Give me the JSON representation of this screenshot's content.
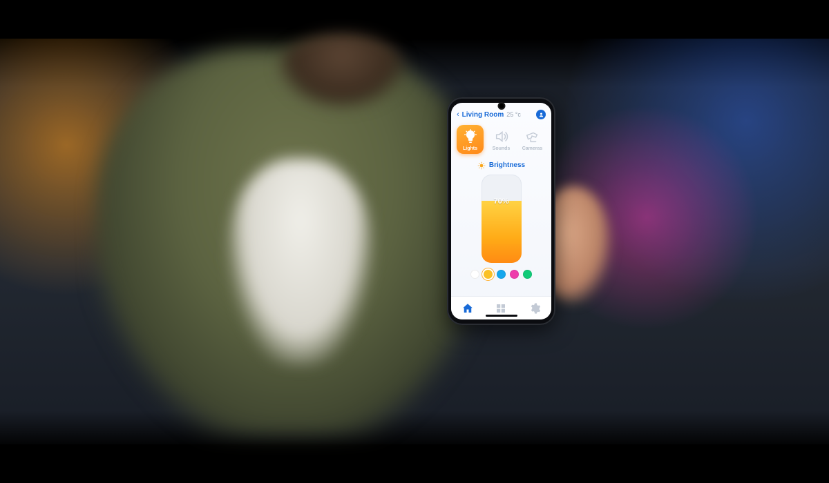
{
  "header": {
    "back_glyph": "‹",
    "room_name": "Living Room",
    "temperature": "25 °c"
  },
  "tabs": [
    {
      "id": "lights",
      "label": "Lights",
      "active": true
    },
    {
      "id": "sounds",
      "label": "Sounds",
      "active": false
    },
    {
      "id": "cameras",
      "label": "Cameras",
      "active": false
    }
  ],
  "section": {
    "title": "Brightness"
  },
  "brightness": {
    "percent": 70,
    "label": "70%"
  },
  "colors": [
    {
      "hex": "#ffffff",
      "selected": false
    },
    {
      "hex": "#f7c02c",
      "selected": true
    },
    {
      "hex": "#1aa6e8",
      "selected": false
    },
    {
      "hex": "#e83fa8",
      "selected": false
    },
    {
      "hex": "#17c97a",
      "selected": false
    }
  ],
  "bottom_nav": [
    {
      "id": "home",
      "active": true
    },
    {
      "id": "rooms",
      "active": false
    },
    {
      "id": "settings",
      "active": false
    }
  ]
}
